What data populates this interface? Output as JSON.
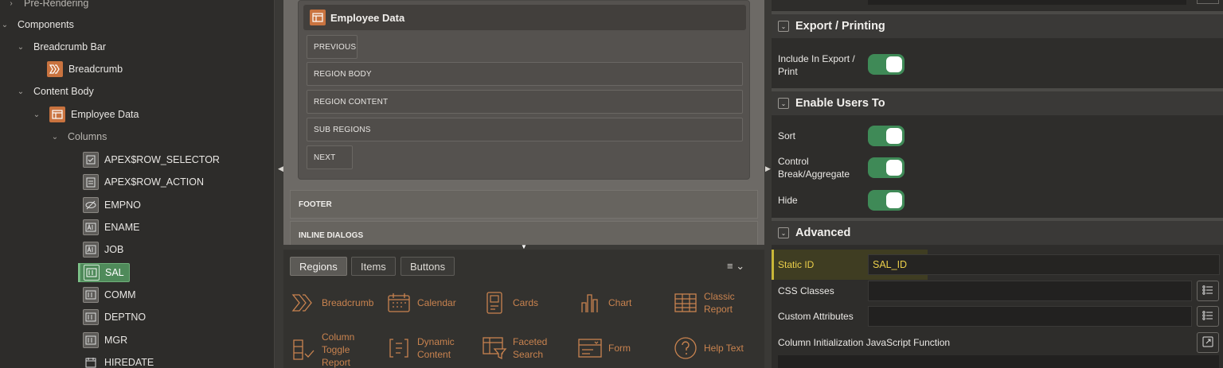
{
  "tree": {
    "items": [
      {
        "label": "Pre-Rendering"
      },
      {
        "label": "Components"
      },
      {
        "label": "Breadcrumb Bar"
      },
      {
        "label": "Breadcrumb"
      },
      {
        "label": "Content Body"
      },
      {
        "label": "Employee Data"
      },
      {
        "label": "Columns"
      },
      {
        "label": "APEX$ROW_SELECTOR"
      },
      {
        "label": "APEX$ROW_ACTION"
      },
      {
        "label": "EMPNO"
      },
      {
        "label": "ENAME"
      },
      {
        "label": "JOB"
      },
      {
        "label": "SAL"
      },
      {
        "label": "COMM"
      },
      {
        "label": "DEPTNO"
      },
      {
        "label": "MGR"
      },
      {
        "label": "HIREDATE"
      }
    ]
  },
  "layout": {
    "region_title": "Employee Data",
    "slots": [
      "PREVIOUS",
      "REGION BODY",
      "REGION CONTENT",
      "SUB REGIONS",
      "NEXT"
    ],
    "footer": "FOOTER",
    "inline_dialogs": "INLINE DIALOGS"
  },
  "gallery": {
    "tabs": [
      "Regions",
      "Items",
      "Buttons"
    ],
    "items": [
      {
        "label": "Breadcrumb",
        "icon": "breadcrumb-icon"
      },
      {
        "label": "Calendar",
        "icon": "calendar-icon"
      },
      {
        "label": "Cards",
        "icon": "cards-icon"
      },
      {
        "label": "Chart",
        "icon": "chart-icon"
      },
      {
        "label": "Classic Report",
        "icon": "classic-report-icon"
      },
      {
        "label": "Column Toggle Report",
        "icon": "column-toggle-icon"
      },
      {
        "label": "Dynamic Content",
        "icon": "dynamic-content-icon"
      },
      {
        "label": "Faceted Search",
        "icon": "faceted-search-icon"
      },
      {
        "label": "Form",
        "icon": "form-icon"
      },
      {
        "label": "Help Text",
        "icon": "help-text-icon"
      }
    ]
  },
  "props": {
    "export_group": "Export / Printing",
    "include_in_export": "Include In Export / Print",
    "enable_group": "Enable Users To",
    "sort": "Sort",
    "control_break": "Control Break/Aggregate",
    "hide": "Hide",
    "advanced_group": "Advanced",
    "static_id_label": "Static ID",
    "static_id_value": "SAL_ID",
    "css_classes": "CSS Classes",
    "custom_attributes": "Custom Attributes",
    "column_init_js": "Column Initialization JavaScript Function"
  },
  "colors": {
    "accent_green": "#3f8a57",
    "icon_orange": "#c9733f",
    "highlight_yellow": "#ecd04a"
  }
}
